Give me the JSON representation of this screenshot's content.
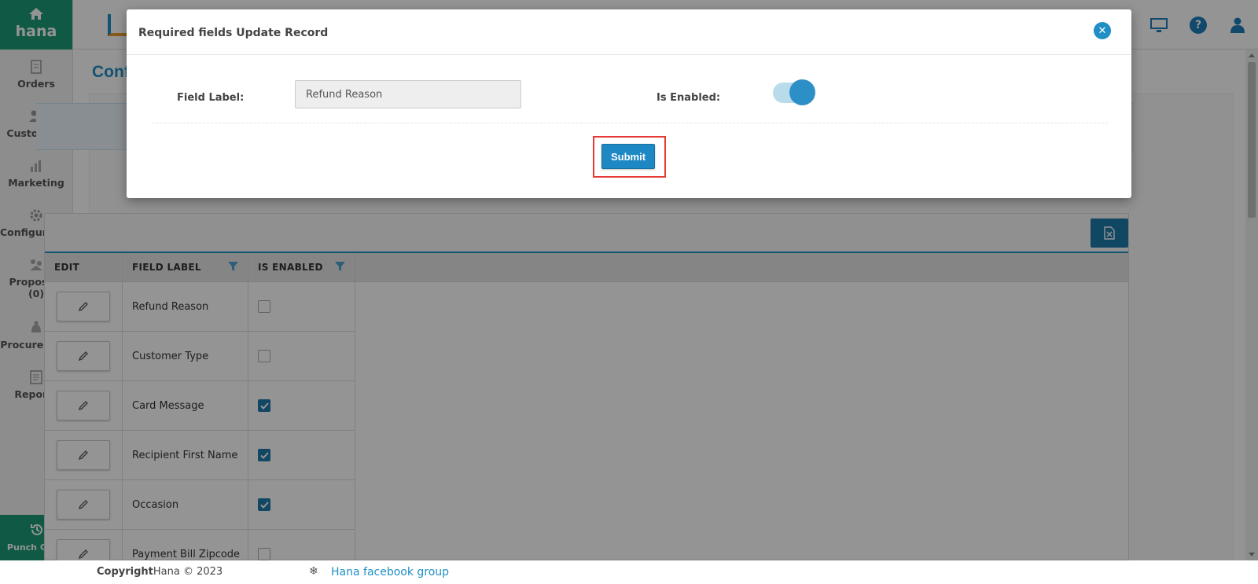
{
  "app": {
    "logo_text": "hana",
    "page_title": "Conf"
  },
  "sidebar": {
    "items": [
      {
        "label": "Orders",
        "icon": "orders-icon"
      },
      {
        "label": "Customers",
        "icon": "customers-icon"
      },
      {
        "label": "Marketing",
        "icon": "marketing-icon"
      },
      {
        "label": "Configuration",
        "icon": "gear-icon"
      },
      {
        "label": "Proposals",
        "count": "(0)",
        "icon": "proposals-icon"
      },
      {
        "label": "Procurement",
        "icon": "procurement-icon"
      },
      {
        "label": "Reports",
        "icon": "reports-icon"
      }
    ],
    "punch_clock": "Punch Clock"
  },
  "header": {
    "icons": [
      "monitor-icon",
      "help-icon",
      "user-icon"
    ],
    "help_glyph": "?"
  },
  "grid": {
    "columns": [
      "EDIT",
      "FIELD LABEL",
      "IS ENABLED"
    ],
    "rows": [
      {
        "label": "Refund Reason",
        "enabled": false
      },
      {
        "label": "Customer Type",
        "enabled": false
      },
      {
        "label": "Card Message",
        "enabled": true
      },
      {
        "label": "Recipient First Name",
        "enabled": true
      },
      {
        "label": "Occasion",
        "enabled": true
      },
      {
        "label": "Payment Bill Zipcode",
        "enabled": false
      }
    ]
  },
  "footer": {
    "copyright_label": "Copyright",
    "copyright_text": "Hana © 2023",
    "link": "Hana facebook group"
  },
  "modal": {
    "title": "Required fields Update Record",
    "field_label": "Field Label:",
    "field_value": "Refund Reason",
    "enabled_label": "Is Enabled:",
    "enabled_value": true,
    "submit": "Submit"
  },
  "colors": {
    "brand_green": "#1a9a78",
    "accent_blue": "#1f8fc4",
    "highlight_red": "#e53935"
  }
}
